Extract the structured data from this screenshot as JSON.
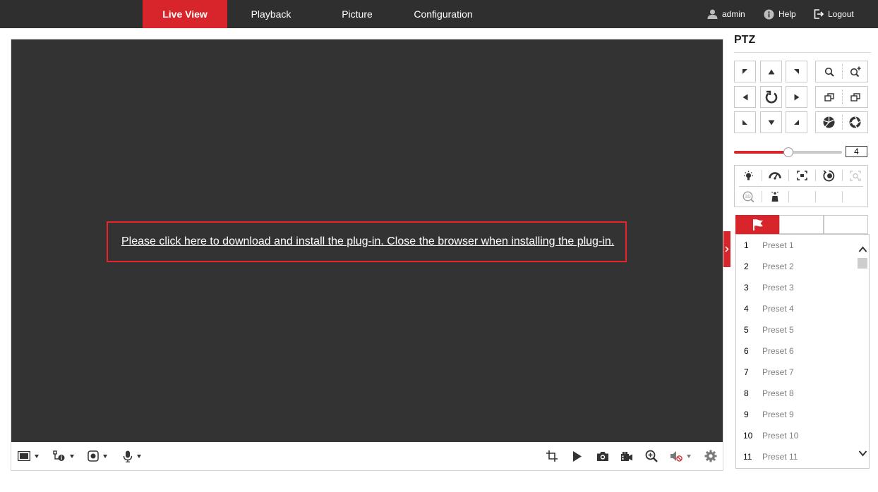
{
  "nav": {
    "tabs": [
      {
        "label": "Live View",
        "active": true
      },
      {
        "label": "Playback",
        "active": false
      },
      {
        "label": "Picture",
        "active": false
      },
      {
        "label": "Configuration",
        "active": false
      }
    ],
    "user": "admin",
    "help": "Help",
    "logout": "Logout"
  },
  "video": {
    "plugin_message": "Please click here to download and install the plug-in. Close the browser when installing the plug-in."
  },
  "ptz": {
    "title": "PTZ",
    "speed": "4",
    "speed_level": 0.5
  },
  "presets": [
    {
      "num": "1",
      "name": "Preset 1"
    },
    {
      "num": "2",
      "name": "Preset 2"
    },
    {
      "num": "3",
      "name": "Preset 3"
    },
    {
      "num": "4",
      "name": "Preset 4"
    },
    {
      "num": "5",
      "name": "Preset 5"
    },
    {
      "num": "6",
      "name": "Preset 6"
    },
    {
      "num": "7",
      "name": "Preset 7"
    },
    {
      "num": "8",
      "name": "Preset 8"
    },
    {
      "num": "9",
      "name": "Preset 9"
    },
    {
      "num": "10",
      "name": "Preset 10"
    },
    {
      "num": "11",
      "name": "Preset 11"
    }
  ],
  "colors": {
    "accent": "#d8252b",
    "topbar": "#2f2f2f",
    "video_bg": "#333333",
    "highlight_border": "#e8232a"
  }
}
